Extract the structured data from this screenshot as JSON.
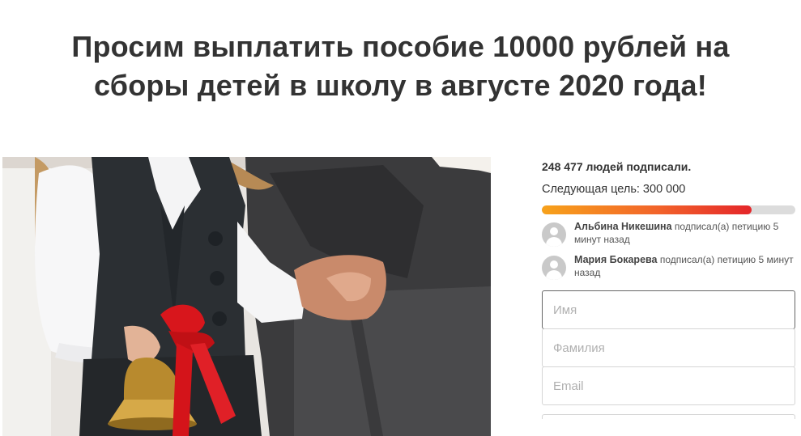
{
  "petition": {
    "title_line1": "Просим выплатить пособие 10000 рублей на",
    "title_line2": "сборы детей в школу в августе 2020 года!"
  },
  "stats": {
    "signed_text": "248 477 людей подписали.",
    "goal_text": "Следующая цель: 300 000",
    "signed": 248477,
    "goal": 300000,
    "progress_fraction": 0.828
  },
  "signers": [
    {
      "name": "Альбина Никешина",
      "action": "подписал(а) петицию 5 минут назад"
    },
    {
      "name": "Мария Бокарева",
      "action": "подписал(а) петицию 5 минут назад"
    }
  ],
  "form": {
    "first_name_placeholder": "Имя",
    "last_name_placeholder": "Фамилия",
    "email_placeholder": "Email"
  },
  "colors": {
    "progress_start": "#f7a21b",
    "progress_end": "#e4262a",
    "progress_track": "#dcdcdc",
    "title": "#333333"
  }
}
